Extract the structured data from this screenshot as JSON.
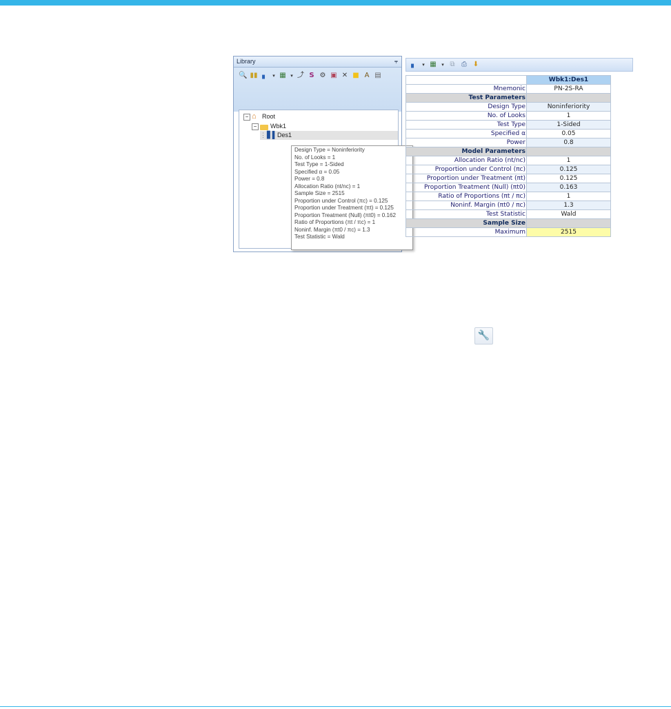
{
  "library": {
    "title": "Library",
    "pin": "⫧",
    "toolbar_icons": [
      "magnifier-icon",
      "columns-icon",
      "chart-icon",
      "table-icon",
      "wand-icon",
      "s-icon",
      "gears-icon",
      "save-icon",
      "delete-icon",
      "note-icon",
      "text-edit-icon",
      "disk-icon"
    ],
    "tree": {
      "root": "Root",
      "workbook": "Wbk1",
      "design": "Des1"
    }
  },
  "tooltip": {
    "lines": [
      "Design Type = Noninferiority",
      "No. of Looks = 1",
      "Test Type = 1-Sided",
      "Specified α = 0.05",
      "Power = 0.8",
      "Allocation Ratio (nt/nc) = 1",
      "Sample Size = 2515",
      "Proportion under Control (πc) = 0.125",
      "Proportion under Treatment (πt) = 0.125",
      "Proportion Treatment (Null) (πt0) = 0.162",
      "Ratio of Proportions (πt / πc) = 1",
      "Noninf. Margin (πt0 / πc) = 1.3",
      "Test Statistic = Wald"
    ]
  },
  "results": {
    "column_header": "Wbk1:Des1",
    "rows": [
      {
        "kind": "row",
        "label": "Mnemonic",
        "value": "PN-2S-RA"
      },
      {
        "kind": "section",
        "label": "Test Parameters",
        "value": ""
      },
      {
        "kind": "row",
        "label": "Design Type",
        "value": "Noninferiority"
      },
      {
        "kind": "row",
        "label": "No. of Looks",
        "value": "1"
      },
      {
        "kind": "row",
        "label": "Test Type",
        "value": "1-Sided"
      },
      {
        "kind": "row",
        "label": "Specified α",
        "value": "0.05"
      },
      {
        "kind": "row",
        "label": "Power",
        "value": "0.8"
      },
      {
        "kind": "section",
        "label": "Model Parameters",
        "value": ""
      },
      {
        "kind": "row",
        "label": "Allocation Ratio (nt/nc)",
        "value": "1"
      },
      {
        "kind": "row",
        "label": "Proportion under Control (πc)",
        "value": "0.125"
      },
      {
        "kind": "row",
        "label": "Proportion under Treatment (πt)",
        "value": "0.125"
      },
      {
        "kind": "row",
        "label": "Proportion Treatment (Null) (πt0)",
        "value": "0.163"
      },
      {
        "kind": "row",
        "label": "Ratio of Proportions (πt / πc)",
        "value": "1"
      },
      {
        "kind": "row",
        "label": "Noninf. Margin (πt0 / πc)",
        "value": "1.3"
      },
      {
        "kind": "row",
        "label": "Test Statistic",
        "value": "Wald"
      },
      {
        "kind": "section",
        "label": "Sample Size",
        "value": ""
      },
      {
        "kind": "max",
        "label": "Maximum",
        "value": "2515"
      }
    ]
  },
  "colors": {
    "accent_bar": "#35b5e8",
    "header_blue": "#aed2f2",
    "section_gray": "#d7d7d7",
    "highlight_yellow": "#fdfca8"
  }
}
